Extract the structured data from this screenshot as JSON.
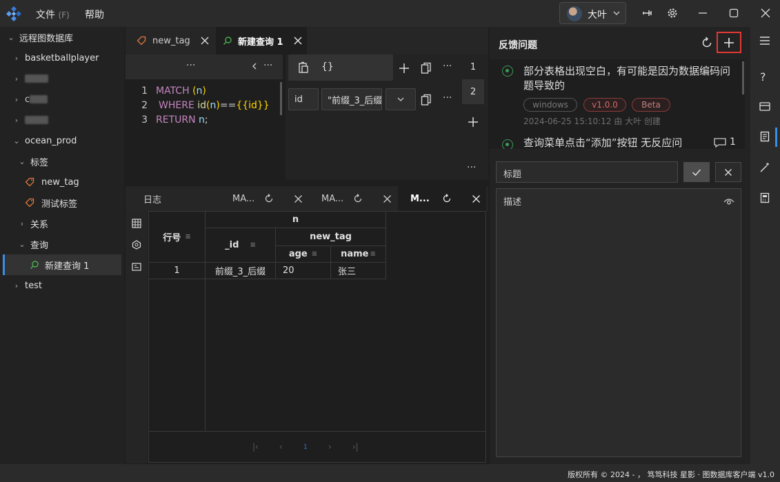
{
  "menu": {
    "file": "文件",
    "file_hotkey": "(F)",
    "help": "帮助"
  },
  "user": {
    "name": "大叶"
  },
  "sidebar": {
    "root": "远程图数据库",
    "items": [
      "basketballplayer",
      "ocean_prod",
      "标签",
      "new_tag",
      "测试标签",
      "关系",
      "查询",
      "新建查询 1",
      "test"
    ],
    "partial_letter": "c"
  },
  "tabs": [
    {
      "label": "new_tag"
    },
    {
      "label": "新建查询 1"
    }
  ],
  "editor": {
    "menu_dots": "···",
    "lines": [
      {
        "num": "1",
        "kw": "MATCH",
        "rest_a": "(",
        "var": "n",
        "rest_b": ")"
      },
      {
        "num": "2",
        "kw": "WHERE",
        "fn": "id",
        "p1": "(",
        "var": "n",
        "p2": ")",
        "op": "==",
        "tmpl": "{{id}}"
      },
      {
        "num": "3",
        "kw": "RETURN",
        "var": "n",
        "end": ";"
      }
    ]
  },
  "params": {
    "braces": "{}",
    "field_name": "id",
    "field_value": "\"前缀_3_后缀",
    "row_nums": [
      "1",
      "2"
    ]
  },
  "result_tabs": {
    "log": "日志",
    "t1": "MA...",
    "t2": "MA...",
    "t3": "M..."
  },
  "table": {
    "group_header": "n",
    "row_header": "行号",
    "id_header": "_id",
    "sub_group": "new_tag",
    "cols": [
      "age",
      "name"
    ],
    "rows": [
      {
        "row": "1",
        "id": "前缀_3_后缀",
        "age": "20",
        "name": "张三"
      }
    ],
    "page": "1"
  },
  "feedback": {
    "title": "反馈问题",
    "issues": [
      {
        "title": "部分表格出现空白，有可能是因为数据编码问题导致的",
        "tags": [
          "windows",
          "v1.0.0",
          "Beta"
        ],
        "meta": "2024-06-25 15:10:12 由 大叶 创建"
      },
      {
        "title": "查询菜单点击“添加”按钮 无反应问",
        "comments": "1"
      }
    ],
    "form": {
      "title_placeholder": "标题",
      "desc_placeholder": "描述"
    }
  },
  "activity_icons": [
    "menu-icon",
    "help-icon",
    "card-icon",
    "document-icon",
    "magic-wand-icon",
    "calculator-icon"
  ],
  "status": {
    "text": "版权所有 © 2024 - ， 笃笃科技  星影 · 图数据库客户端  v1.0"
  },
  "colors": {
    "keyword": "#c586c0",
    "function": "#dcdcaa",
    "variable": "#9cdcfe",
    "bracket": "#ffd700",
    "highlight": "#e53935",
    "success": "#3d9a5a"
  }
}
